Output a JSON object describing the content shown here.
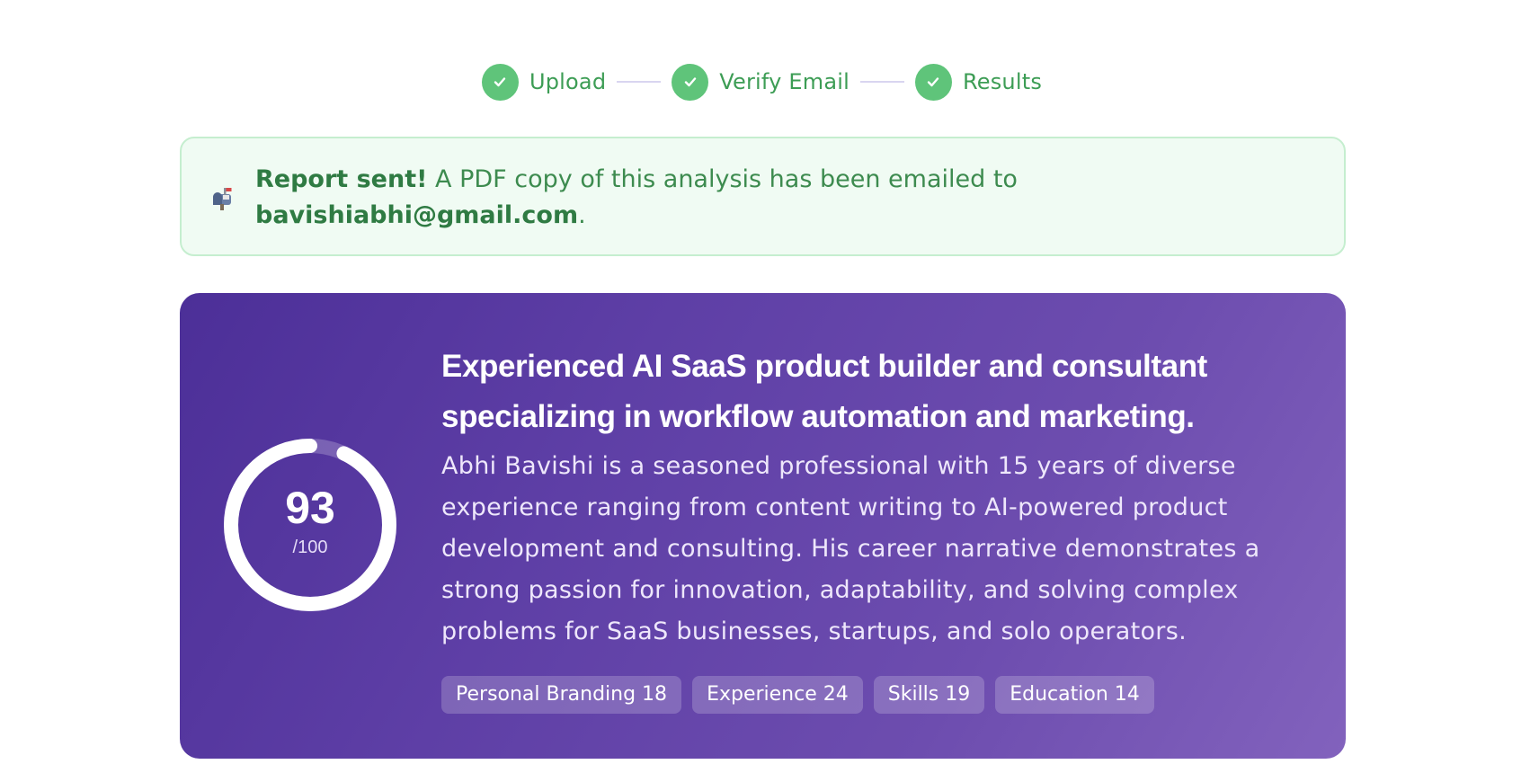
{
  "stepper": {
    "steps": [
      {
        "label": "Upload",
        "status": "complete"
      },
      {
        "label": "Verify Email",
        "status": "complete"
      },
      {
        "label": "Results",
        "status": "complete"
      }
    ]
  },
  "alert": {
    "icon": "mailbox-icon",
    "title": "Report sent!",
    "message": " A PDF copy of this analysis has been emailed to ",
    "email": "bavishiabhi@gmail.com",
    "period": "."
  },
  "summary_card": {
    "score": "93",
    "score_max": "/100",
    "score_fraction": 0.93,
    "headline": "Experienced AI SaaS product builder and consultant specializing in workflow automation and marketing.",
    "summary": "Abhi Bavishi is a seasoned professional with 15 years of diverse experience ranging from content writing to AI-powered product development and consulting. His career narrative demonstrates a strong passion for innovation, adaptability, and solving complex problems for SaaS businesses, startups, and solo operators.",
    "tags": [
      {
        "label": "Personal Branding 18"
      },
      {
        "label": "Experience 24"
      },
      {
        "label": "Skills 19"
      },
      {
        "label": "Education 14"
      }
    ]
  },
  "colors": {
    "success": "#5fc47a",
    "success_text": "#3d9d55",
    "card_gradient_start": "#4c2f98",
    "card_gradient_end": "#8262bd"
  }
}
